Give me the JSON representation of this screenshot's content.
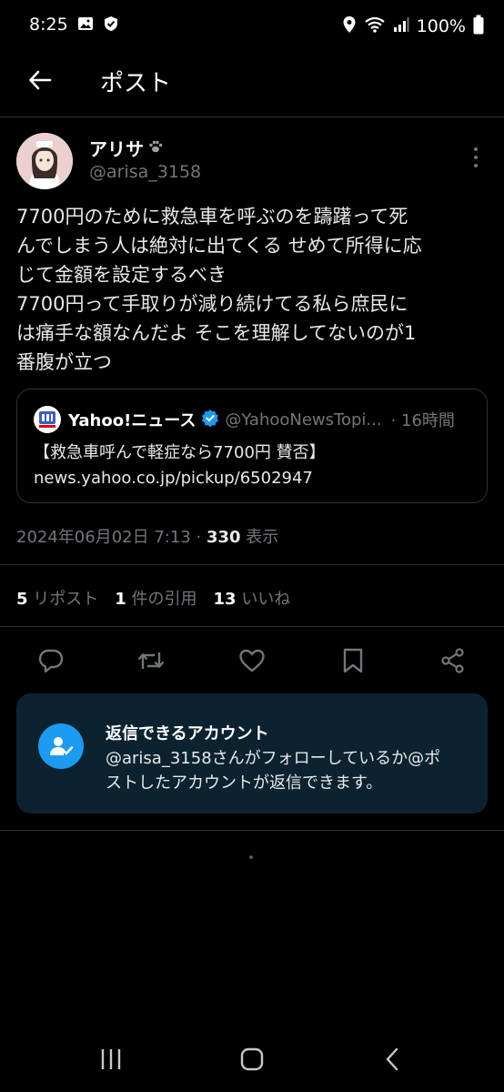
{
  "status_bar": {
    "time": "8:25",
    "battery": "100%"
  },
  "header": {
    "title": "ポスト"
  },
  "post": {
    "author_name": "アリサ",
    "author_handle": "@arisa_3158",
    "text_lines": [
      "7700円のために救急車を呼ぶのを躊躇って死",
      "んでしまう人は絶対に出てくる せめて所得に応",
      "じて金額を設定するべき",
      "7700円って手取りが減り続けてる私ら庶民に",
      "は痛手な額なんだよ そこを理解してないのが1",
      "番腹が立つ"
    ],
    "quote": {
      "name": "Yahoo!ニュース",
      "handle": "@YahooNewsTopi...",
      "time": "· 16時間",
      "line1": "【救急車呼んで軽症なら7700円 賛否】",
      "line2": "news.yahoo.co.jp/pickup/6502947"
    },
    "timestamp": "2024年06月02日 7:13 · ",
    "views_count": "330",
    "views_label": " 表示"
  },
  "stats": {
    "reposts_count": "5",
    "reposts_label": "リポスト",
    "quotes_count": "1",
    "quotes_label": "件の引用",
    "likes_count": "13",
    "likes_label": "いいね"
  },
  "reply_restriction": {
    "title": "返信できるアカウント",
    "line1": "@arisa_3158さんがフォローしているか@ポ",
    "line2": "ストしたアカウントが返信できます。"
  },
  "colors": {
    "background": "#000000",
    "accent": "#1d9bf0",
    "muted": "#71767b",
    "reply_box": "#0d2230"
  }
}
